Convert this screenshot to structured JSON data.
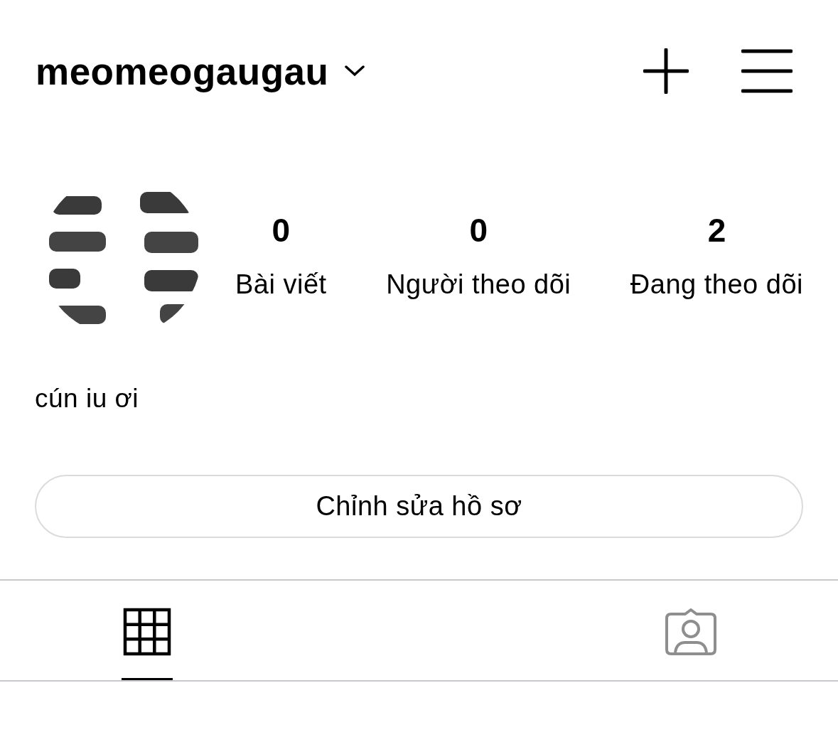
{
  "header": {
    "username": "meomeogaugau"
  },
  "profile": {
    "stats": [
      {
        "value": "0",
        "label": "Bài viết"
      },
      {
        "value": "0",
        "label": "Người theo dõi"
      },
      {
        "value": "2",
        "label": "Đang theo dõi"
      }
    ],
    "bio": "cún iu ơi"
  },
  "edit_button": "Chỉnh sửa hồ sơ",
  "tabs": [
    {
      "kind": "grid",
      "selected": true
    },
    {
      "kind": "tagged",
      "selected": false
    }
  ]
}
